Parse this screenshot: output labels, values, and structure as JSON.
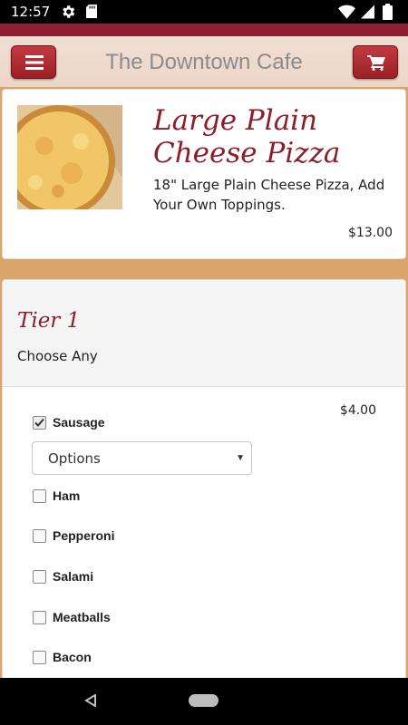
{
  "status_bar": {
    "time": "12:57",
    "icons": [
      "gear-icon",
      "sd-card-icon",
      "wifi-icon",
      "signal-icon",
      "battery-icon"
    ]
  },
  "header": {
    "title": "The Downtown Cafe",
    "menu_icon": "menu-icon",
    "cart_icon": "cart-icon"
  },
  "product": {
    "title": "Large Plain Cheese Pizza",
    "description": "18\" Large Plain Cheese Pizza, Add Your Own Toppings.",
    "price": "$13.00"
  },
  "tier": {
    "title": "Tier 1",
    "subtitle": "Choose Any",
    "price": "$4.00",
    "select_value": "Options",
    "options": [
      {
        "label": "Sausage",
        "checked": true
      },
      {
        "label": "Ham",
        "checked": false
      },
      {
        "label": "Pepperoni",
        "checked": false
      },
      {
        "label": "Salami",
        "checked": false
      },
      {
        "label": "Meatballs",
        "checked": false
      },
      {
        "label": "Bacon",
        "checked": false
      }
    ]
  },
  "colors": {
    "accent": "#8a1f2b",
    "button": "#b0282f",
    "background": "#d9a56a"
  }
}
